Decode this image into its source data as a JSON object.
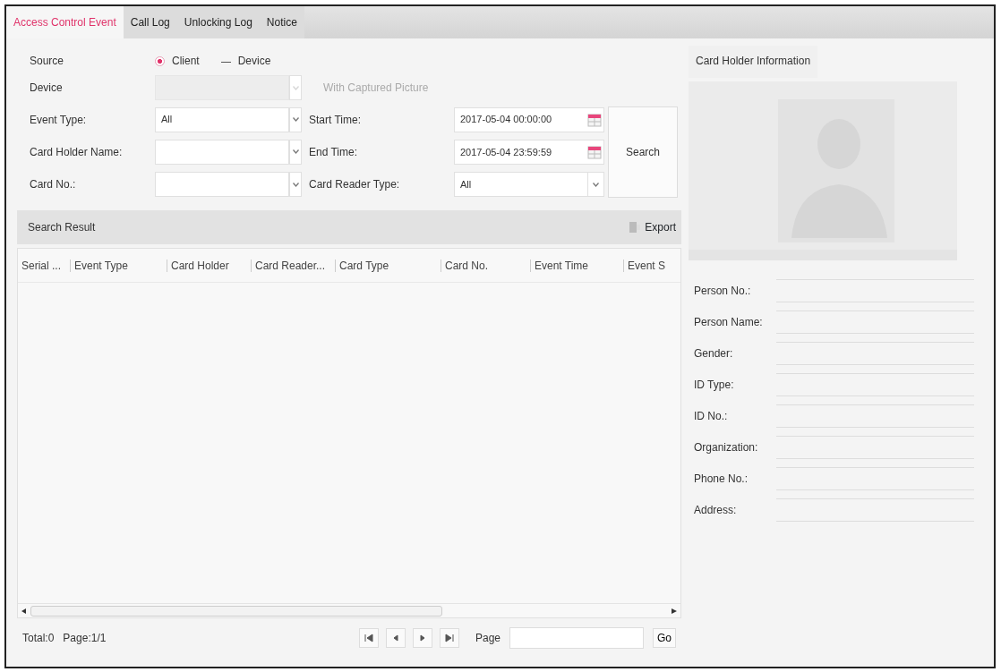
{
  "tabs": [
    {
      "label": "Access Control Event",
      "selected": true
    },
    {
      "label": "Call Log",
      "selected": false
    },
    {
      "label": "Unlocking Log",
      "selected": false
    },
    {
      "label": "Notice",
      "selected": false
    }
  ],
  "filters": {
    "source_label": "Source",
    "source_options": [
      {
        "label": "Client",
        "selected": true
      },
      {
        "label": "Device",
        "selected": false
      }
    ],
    "device_label": "Device",
    "device_select": {
      "disabled": true
    },
    "captured_picture": {
      "label": "With Captured Picture",
      "disabled": true
    },
    "rows": [
      {
        "label": "Event Type:",
        "value": "All",
        "right_label": "Start Time:",
        "kind": "datetime",
        "right_value": "2017-05-04 00:00:00"
      },
      {
        "label": "Card Holder Name:",
        "value": "",
        "right_label": "End Time:",
        "kind": "datetime",
        "right_value": "2017-05-04 23:59:59"
      },
      {
        "label": "Card No.:",
        "value": "",
        "right_label": "Card Reader Type:",
        "kind": "select",
        "right_value": "All"
      }
    ],
    "search_button": "Search"
  },
  "results": {
    "title": "Search Result",
    "export_button": "Export",
    "columns": [
      "Serial ...",
      "Event Type",
      "Card Holder",
      "Card Reader...",
      "Card Type",
      "Card No.",
      "Event Time",
      "Event S"
    ]
  },
  "footer": {
    "total": "Total:0",
    "page_info": "Page:1/1",
    "page_label": "Page",
    "go_button": "Go"
  },
  "card_holder": {
    "title": "Card Holder Information",
    "fields": [
      "Person No.:",
      "Person Name:",
      "Gender:",
      "ID Type:",
      "ID No.:",
      "Organization:",
      "Phone No.:",
      "Address:"
    ]
  }
}
